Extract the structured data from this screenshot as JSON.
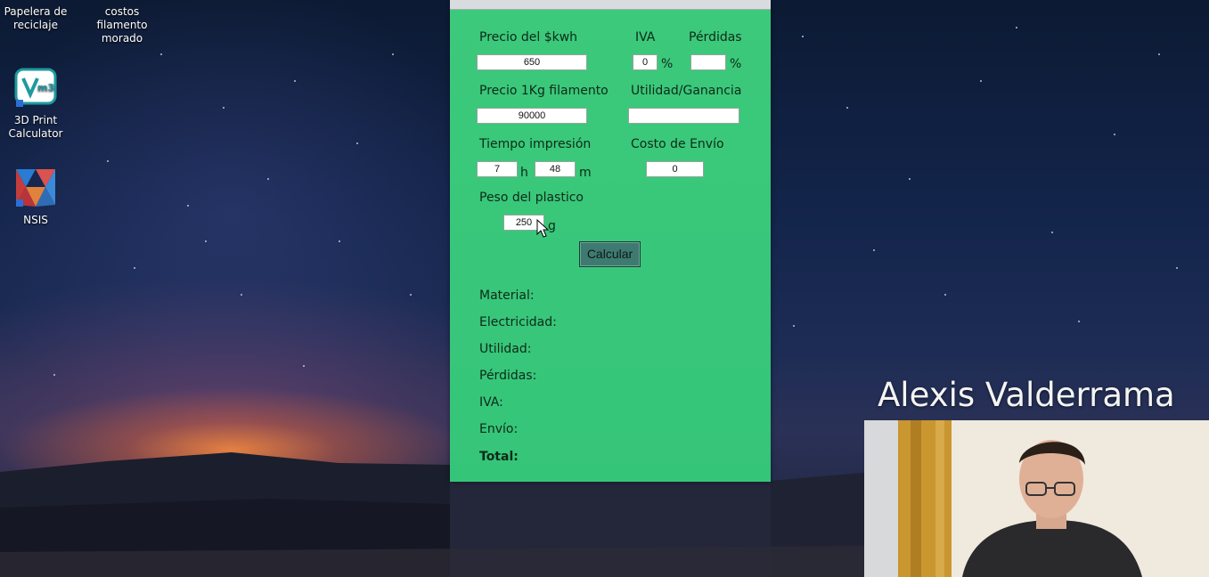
{
  "desktop": {
    "icons": [
      {
        "label": "Papelera de\nreciclaje",
        "icon": "recycle-bin-icon"
      },
      {
        "label": "costos filamento\nmorado",
        "icon": "shortcut-icon"
      },
      {
        "label": "3D Print\nCalculator",
        "icon": "vm3-app-icon"
      },
      {
        "label": "NSIS",
        "icon": "nsis-icon"
      }
    ]
  },
  "form": {
    "precio_kwh_label": "Precio del $kwh",
    "precio_kwh_value": "650",
    "iva_label": "IVA",
    "iva_value": "0",
    "iva_unit": "%",
    "perdidas_label": "Pérdidas",
    "perdidas_value": "",
    "perdidas_unit": "%",
    "filamento_label": "Precio 1Kg filamento",
    "filamento_value": "90000",
    "utilidad_label": "Utilidad/Ganancia",
    "utilidad_value": "",
    "tiempo_label": "Tiempo impresión",
    "horas_value": "7",
    "horas_unit": "h",
    "minutos_value": "48",
    "minutos_unit": "m",
    "envio_label": "Costo de Envío",
    "envio_value": "0",
    "peso_label": "Peso del plastico",
    "peso_value": "250",
    "peso_unit": "g",
    "calcular_label": "Calcular"
  },
  "results": {
    "material": "Material:",
    "electricidad": "Electricidad:",
    "utilidad": "Utilidad:",
    "perdidas": "Pérdidas:",
    "iva": "IVA:",
    "envio": "Envío:",
    "total": "Total:"
  },
  "presenter": {
    "name": "Alexis Valderrama"
  },
  "colors": {
    "window_bg": "#3cc97b",
    "button_bg": "#3f7a70"
  }
}
